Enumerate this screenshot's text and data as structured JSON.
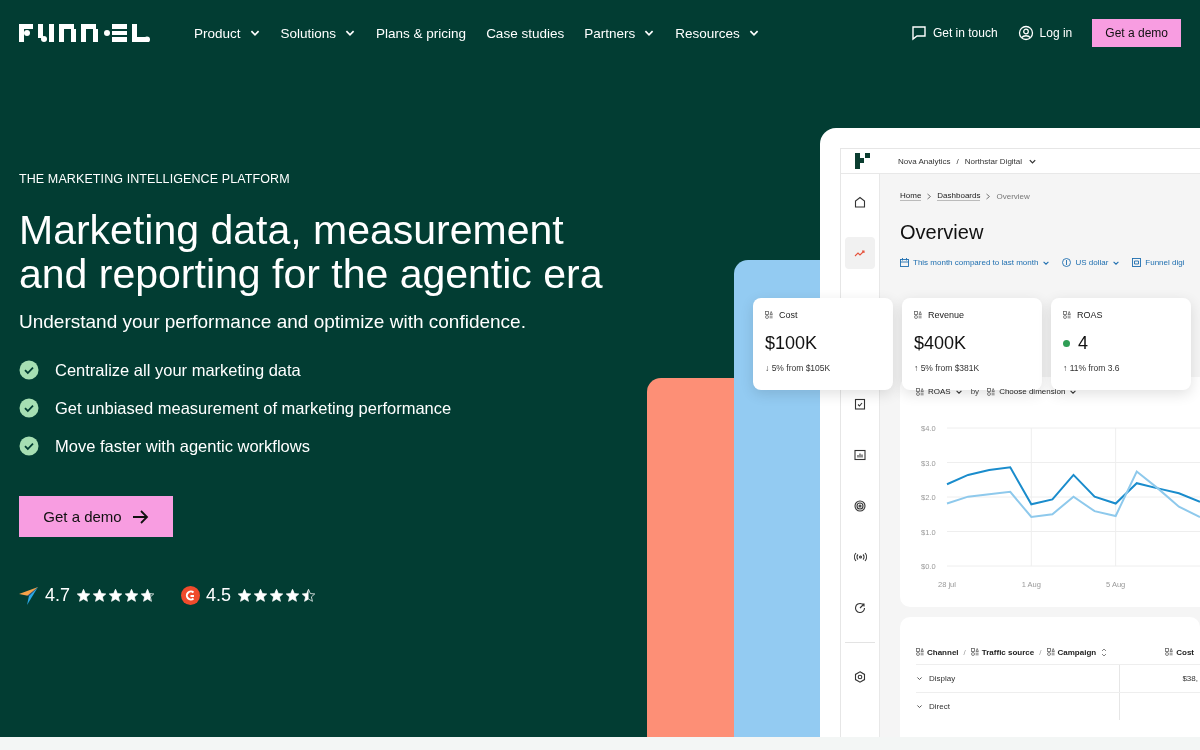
{
  "nav": {
    "items": [
      {
        "label": "Product",
        "dropdown": true
      },
      {
        "label": "Solutions",
        "dropdown": true
      },
      {
        "label": "Plans & pricing",
        "dropdown": false
      },
      {
        "label": "Case studies",
        "dropdown": false
      },
      {
        "label": "Partners",
        "dropdown": true
      },
      {
        "label": "Resources",
        "dropdown": true
      }
    ],
    "actions": [
      {
        "kind": "contact",
        "label": "Get in touch"
      },
      {
        "kind": "login",
        "label": "Log in"
      },
      {
        "kind": "cta",
        "label": "Get a demo"
      }
    ]
  },
  "hero": {
    "eyebrow": "THE MARKETING INTELLIGENCE PLATFORM",
    "title": [
      "Marketing data, measurement",
      "and reporting for the agentic era"
    ],
    "subtitle": "Understand your performance and optimize with confidence.",
    "benefits": [
      "Centralize all your marketing data",
      "Get unbiased measurement of marketing performance",
      "Move faster with agentic workflows"
    ],
    "cta": "Get a demo",
    "ratings": [
      {
        "kind": "plane",
        "score": "4.7",
        "stars": 4.7
      },
      {
        "kind": "badge",
        "score": "4.5",
        "stars": 4.5
      }
    ]
  },
  "dashboard": {
    "workspace": "Nova Analytics",
    "separator": "/",
    "account": "Northstar Digital",
    "sidebar": {
      "top": [
        {
          "kind": "home",
          "selected": false
        },
        {
          "kind": "trend",
          "selected": true
        }
      ],
      "middle": [
        {
          "kind": "checklist",
          "selected": false
        },
        {
          "kind": "bars",
          "selected": false
        },
        {
          "kind": "target",
          "selected": false
        },
        {
          "kind": "broadcast",
          "selected": false
        },
        {
          "kind": "refresh",
          "selected": false
        }
      ],
      "bottom": [
        {
          "kind": "settings",
          "selected": false
        }
      ]
    },
    "breadcrumbs": [
      "Home",
      "Dashboards",
      "Overview"
    ],
    "title": "Overview",
    "filters": [
      {
        "kind": "calendar",
        "label": "This month compared to last month",
        "dropdown": true
      },
      {
        "kind": "currency",
        "label": "US dollar",
        "dropdown": true
      },
      {
        "kind": "source",
        "label": "Funnel digi",
        "dropdown": false
      }
    ],
    "kpis": [
      {
        "label": "Cost",
        "value": "$100K",
        "arrow": "↓",
        "change": "5% from $105K"
      },
      {
        "label": "Revenue",
        "value": "$400K",
        "arrow": "↑",
        "change": "5% from $381K"
      },
      {
        "label": "ROAS",
        "value": "4",
        "arrow": "↑",
        "change": "11% from 3.6",
        "color": "#2f9e55"
      }
    ],
    "chart_controls": {
      "metric": "ROAS",
      "joiner": "by",
      "dimension": "Choose dimension"
    },
    "chart_data": {
      "type": "line",
      "grid": true,
      "categories": [
        "28 jul",
        null,
        null,
        null,
        "1 Aug",
        null,
        null,
        null,
        "5 Aug",
        null,
        null,
        null,
        null
      ],
      "ylim": [
        0,
        4
      ],
      "yticks": [
        {
          "value": 4,
          "label": "$4.0"
        },
        {
          "value": 3,
          "label": "$3.0"
        },
        {
          "value": 2,
          "label": "$2.0"
        },
        {
          "value": 1,
          "label": "$1.0"
        },
        {
          "value": 0,
          "label": "$0.0"
        }
      ],
      "series": [
        {
          "color": "#1a8ccc",
          "values": [
            2.37,
            2.64,
            2.78,
            2.86,
            1.79,
            1.93,
            2.64,
            2.01,
            1.81,
            2.4,
            2.25,
            2.11,
            1.86
          ]
        },
        {
          "color": "#8ec9ec",
          "values": [
            1.81,
            2.01,
            2.08,
            2.15,
            1.42,
            1.5,
            2.01,
            1.59,
            1.45,
            2.74,
            2.25,
            1.72,
            1.42
          ]
        }
      ]
    },
    "table": {
      "columns": [
        "Channel",
        "Traffic source",
        "Campaign"
      ],
      "separator": "/",
      "value_column": "Cost",
      "rows": [
        {
          "label": "Display",
          "value": "$38,"
        },
        {
          "label": "Direct"
        }
      ]
    }
  }
}
